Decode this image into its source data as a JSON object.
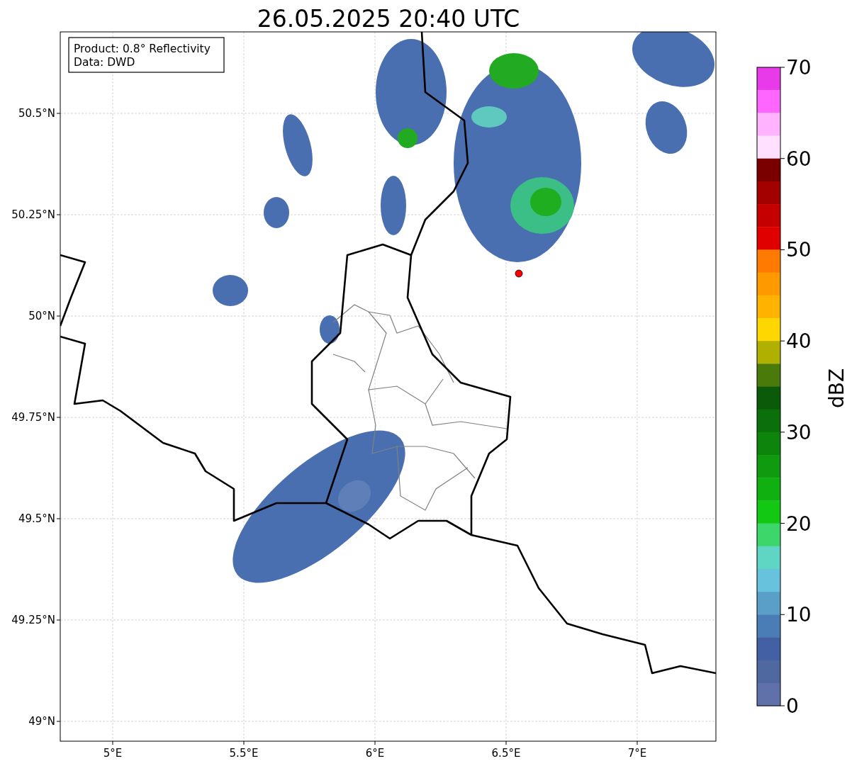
{
  "title": "26.05.2025 20:40 UTC",
  "info_box": {
    "lines": [
      "Product: 0.8° Reflectivity",
      "Data: DWD"
    ]
  },
  "map": {
    "xticks": [
      "5°E",
      "5.5°E",
      "6°E",
      "6.5°E",
      "7°E"
    ],
    "yticks": [
      "50.5°N",
      "50.25°N",
      "50°N",
      "49.75°N",
      "49.5°N",
      "49.25°N",
      "49°N"
    ]
  },
  "colorbar": {
    "label": "dBZ",
    "ticks": [
      "70",
      "60",
      "50",
      "40",
      "30",
      "20",
      "10",
      "0"
    ],
    "bins": [
      {
        "color": "#e83ae8"
      },
      {
        "color": "#ff66ff"
      },
      {
        "color": "#ffb3ff"
      },
      {
        "color": "#ffe0ff"
      },
      {
        "color": "#7a0000"
      },
      {
        "color": "#a30000"
      },
      {
        "color": "#c40000"
      },
      {
        "color": "#e00000"
      },
      {
        "color": "#ff7a00"
      },
      {
        "color": "#ff9900"
      },
      {
        "color": "#ffb300"
      },
      {
        "color": "#ffd700"
      },
      {
        "color": "#b0b000"
      },
      {
        "color": "#4a7a0a"
      },
      {
        "color": "#0a5a0a"
      },
      {
        "color": "#0b700b"
      },
      {
        "color": "#0d850d"
      },
      {
        "color": "#0f9a0f"
      },
      {
        "color": "#10b010"
      },
      {
        "color": "#12c812"
      },
      {
        "color": "#3dd66a"
      },
      {
        "color": "#5fd6c4"
      },
      {
        "color": "#66c2dd"
      },
      {
        "color": "#5a9fc8"
      },
      {
        "color": "#4a7db5"
      },
      {
        "color": "#4360a5"
      },
      {
        "color": "#5068a0"
      },
      {
        "color": "#6070a8"
      }
    ]
  }
}
